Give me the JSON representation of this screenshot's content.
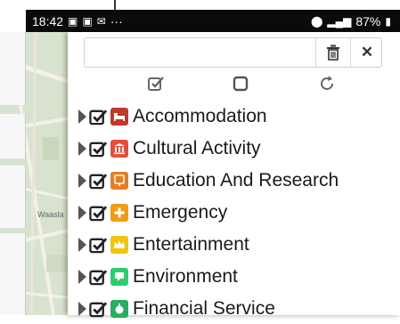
{
  "status_bar": {
    "time": "18:42",
    "left_icons": [
      "gallery-icon",
      "gallery-icon",
      "badge-icon"
    ],
    "more": "···",
    "battery": "87%",
    "right_icons": [
      "location-icon",
      "signal-icon",
      "battery-icon"
    ]
  },
  "map": {
    "label": "Waasla"
  },
  "search": {
    "value": "",
    "placeholder": ""
  },
  "toolbar": {
    "select_all": "check-all-icon",
    "select_none": "uncheck-all-icon",
    "reset": "refresh-icon"
  },
  "categories": [
    {
      "label": "Accommodation",
      "color": "#c0392b",
      "icon": "bed-icon"
    },
    {
      "label": "Cultural Activity",
      "color": "#e74c3c",
      "icon": "museum-icon"
    },
    {
      "label": "Education And Research",
      "color": "#e67e22",
      "icon": "school-icon"
    },
    {
      "label": "Emergency",
      "color": "#f39c12",
      "icon": "plus-icon"
    },
    {
      "label": "Entertainment",
      "color": "#f1c40f",
      "icon": "crown-icon"
    },
    {
      "label": "Environment",
      "color": "#2ecc71",
      "icon": "leaf-icon"
    },
    {
      "label": "Financial Service",
      "color": "#27ae60",
      "icon": "money-icon"
    }
  ]
}
